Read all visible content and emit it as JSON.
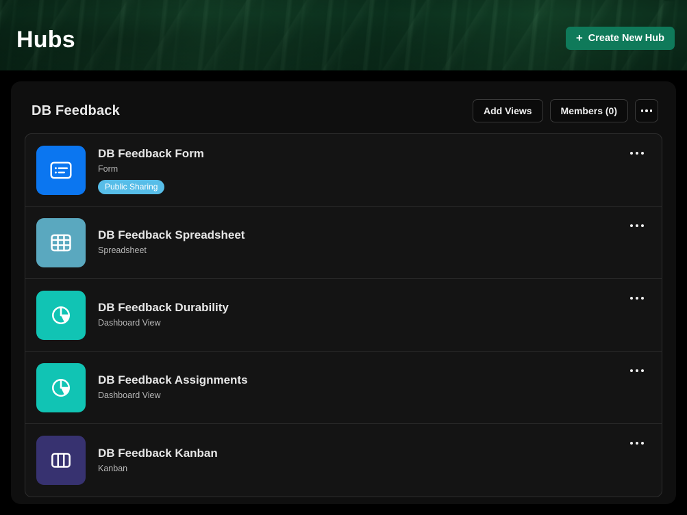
{
  "banner": {
    "title": "Hubs",
    "create_button": {
      "label": "Create New Hub",
      "plus": "+",
      "color": "#0f7a5a"
    }
  },
  "hub": {
    "title": "DB Feedback",
    "actions": {
      "add_views": "Add Views",
      "members": "Members (0)",
      "overflow_menu": "..."
    },
    "views": [
      {
        "name": "DB Feedback Form",
        "type": "Form",
        "badge": "Public Sharing",
        "badge_color": "#57bde8",
        "icon": "form-icon",
        "icon_bg": "#0b76f0"
      },
      {
        "name": "DB Feedback Spreadsheet",
        "type": "Spreadsheet",
        "badge": null,
        "icon": "spreadsheet-grid-icon",
        "icon_bg": "#5aa8bf"
      },
      {
        "name": "DB Feedback Durability",
        "type": "Dashboard View",
        "badge": null,
        "icon": "pie-chart-icon",
        "icon_bg": "#11c4b4"
      },
      {
        "name": "DB Feedback Assignments",
        "type": "Dashboard View",
        "badge": null,
        "icon": "pie-chart-icon",
        "icon_bg": "#11c4b4"
      },
      {
        "name": "DB Feedback Kanban",
        "type": "Kanban",
        "badge": null,
        "icon": "kanban-columns-icon",
        "icon_bg": "#373270"
      }
    ]
  }
}
